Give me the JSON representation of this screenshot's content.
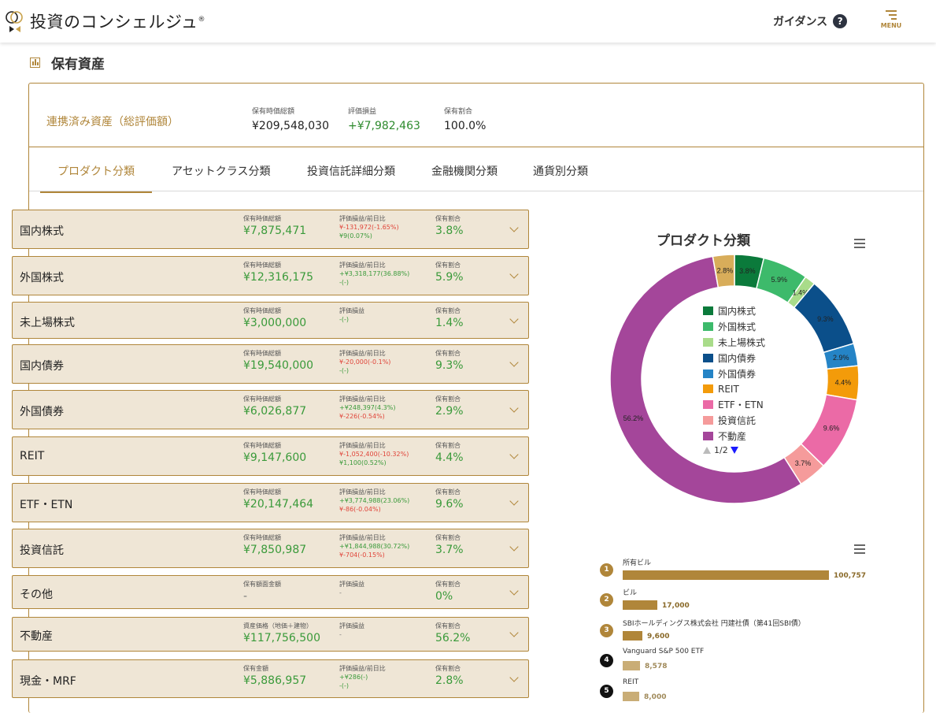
{
  "header": {
    "logo_text": "投資のコンシェルジュ",
    "logo_mark": "®",
    "guidance_label": "ガイダンス",
    "guidance_icon": "?",
    "menu_label": "MENU"
  },
  "page": {
    "title": "保有資産"
  },
  "summary": {
    "label": "連携済み資産（総評価額）",
    "cols": [
      {
        "header": "保有時価総額",
        "value": "¥209,548,030"
      },
      {
        "header": "評価損益",
        "value": "+¥7,982,463"
      },
      {
        "header": "保有割合",
        "value": "100.0%"
      }
    ]
  },
  "tabs": [
    "プロダクト分類",
    "アセットクラス分類",
    "投資信託詳細分類",
    "金融機関分類",
    "通貨別分類"
  ],
  "rows": [
    {
      "name": "国内株式",
      "h1": "保有時価総額",
      "v1": "¥7,875,471",
      "h2": "評価損益/前日比",
      "l1": "¥-131,972(-1.65%)",
      "c1": "red",
      "l2": "¥9(0.07%)",
      "c2": "green",
      "h3": "保有割合",
      "v3": "3.8%"
    },
    {
      "name": "外国株式",
      "h1": "保有時価総額",
      "v1": "¥12,316,175",
      "h2": "評価損益/前日比",
      "l1": "+¥3,318,177(36.88%)",
      "c1": "green",
      "l2": "-(-)",
      "c2": "green",
      "h3": "保有割合",
      "v3": "5.9%"
    },
    {
      "name": "未上場株式",
      "h1": "保有時価総額",
      "v1": "¥3,000,000",
      "h2": "評価損益",
      "l1": "-(-)",
      "c1": "green",
      "l2": "",
      "c2": "green",
      "h3": "保有割合",
      "v3": "1.4%"
    },
    {
      "name": "国内債券",
      "h1": "保有時価総額",
      "v1": "¥19,540,000",
      "h2": "評価損益/前日比",
      "l1": "¥-20,000(-0.1%)",
      "c1": "red",
      "l2": "-(-)",
      "c2": "green",
      "h3": "保有割合",
      "v3": "9.3%"
    },
    {
      "name": "外国債券",
      "h1": "保有時価総額",
      "v1": "¥6,026,877",
      "h2": "評価損益/前日比",
      "l1": "+¥248,397(4.3%)",
      "c1": "green",
      "l2": "¥-226(-0.54%)",
      "c2": "red",
      "h3": "保有割合",
      "v3": "2.9%"
    },
    {
      "name": "REIT",
      "h1": "保有時価総額",
      "v1": "¥9,147,600",
      "h2": "評価損益/前日比",
      "l1": "¥-1,052,400(-10.32%)",
      "c1": "red",
      "l2": "¥1,100(0.52%)",
      "c2": "green",
      "h3": "保有割合",
      "v3": "4.4%"
    },
    {
      "name": "ETF・ETN",
      "h1": "保有時価総額",
      "v1": "¥20,147,464",
      "h2": "評価損益/前日比",
      "l1": "+¥3,774,988(23.06%)",
      "c1": "green",
      "l2": "¥-86(-0.04%)",
      "c2": "red",
      "h3": "保有割合",
      "v3": "9.6%"
    },
    {
      "name": "投資信託",
      "h1": "保有時価総額",
      "v1": "¥7,850,987",
      "h2": "評価損益/前日比",
      "l1": "+¥1,844,988(30.72%)",
      "c1": "green",
      "l2": "¥-704(-0.15%)",
      "c2": "red",
      "h3": "保有割合",
      "v3": "3.7%"
    },
    {
      "name": "その他",
      "h1": "保有額面金額",
      "v1": "-",
      "h2": "評価損益",
      "l1": "-",
      "c1": "gray",
      "l2": "",
      "c2": "gray",
      "h3": "保有割合",
      "v3": "0%"
    },
    {
      "name": "不動産",
      "h1": "資産価格（地価＋建物）",
      "v1": "¥117,756,500",
      "h2": "評価損益",
      "l1": "-",
      "c1": "gray",
      "l2": "",
      "c2": "gray",
      "h3": "保有割合",
      "v3": "56.2%"
    },
    {
      "name": "現金・MRF",
      "h1": "保有金額",
      "v1": "¥5,886,957",
      "h2": "評価損益/前日比",
      "l1": "+¥286(-)",
      "c1": "green",
      "l2": "-(-)",
      "c2": "green",
      "h3": "保有割合",
      "v3": "2.8%"
    }
  ],
  "chart_data": [
    {
      "type": "pie",
      "title": "プロダクト分類",
      "categories": [
        "国内株式",
        "外国株式",
        "未上場株式",
        "国内債券",
        "外国債券",
        "REIT",
        "ETF・ETN",
        "投資信託",
        "不動産",
        "現金・MRF"
      ],
      "values": [
        3.8,
        5.9,
        1.4,
        9.3,
        2.9,
        4.4,
        9.6,
        3.7,
        56.2,
        2.8
      ],
      "labels": [
        "3.8%",
        "5.9%",
        "1.4%",
        "9.3%",
        "2.9%",
        "4.4%",
        "9.6%",
        "3.7%",
        "56.2%",
        "2.8%"
      ],
      "colors": [
        "#0b7a3b",
        "#3dba6b",
        "#a9dc8a",
        "#0b4f8a",
        "#2584c6",
        "#f39b0a",
        "#eb6aa6",
        "#f59b9b",
        "#a4469a",
        "#d8ad5a"
      ],
      "legend_items": [
        "国内株式",
        "外国株式",
        "未上場株式",
        "国内債券",
        "外国債券",
        "REIT",
        "ETF・ETN",
        "投資信託",
        "不動産"
      ],
      "legend_page": "1/2"
    },
    {
      "type": "bar",
      "categories": [
        "所有ビル",
        "ビル",
        "SBIホールディングス株式会社 円建社債（第41回SBI債）",
        "Vanguard S&P 500 ETF",
        "REIT"
      ],
      "values": [
        100757,
        17000,
        9600,
        8578,
        8000
      ],
      "value_labels": [
        "100,757",
        "17,000",
        "9,600",
        "8,578",
        "8,000"
      ],
      "ranks": [
        "1",
        "2",
        "3",
        "4",
        "5"
      ]
    }
  ]
}
